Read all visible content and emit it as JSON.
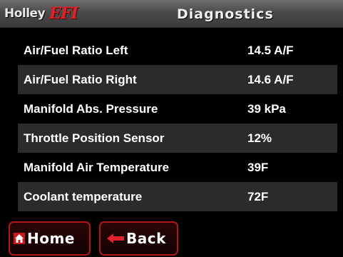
{
  "header": {
    "brand": "Holley",
    "brand_suffix": "EFI",
    "title": "Diagnostics"
  },
  "rows": [
    {
      "label": "Air/Fuel Ratio Left",
      "value": "14.5 A/F"
    },
    {
      "label": "Air/Fuel Ratio Right",
      "value": "14.6 A/F"
    },
    {
      "label": "Manifold Abs. Pressure",
      "value": "39 kPa"
    },
    {
      "label": "Throttle Position Sensor",
      "value": "12%"
    },
    {
      "label": "Manifold Air Temperature",
      "value": "39F"
    },
    {
      "label": "Coolant temperature",
      "value": "72F"
    }
  ],
  "buttons": {
    "home": {
      "label": "Home",
      "icon": "home-icon"
    },
    "back": {
      "label": "Back",
      "icon": "left-arrow-icon"
    }
  },
  "colors": {
    "accent": "#e0202a",
    "button_border": "#b01818",
    "background": "#000000",
    "row_shade": "#2b2b2b"
  }
}
